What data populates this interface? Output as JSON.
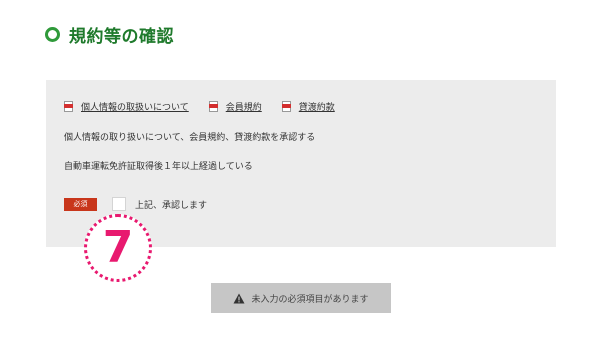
{
  "section": {
    "title": "規約等の確認"
  },
  "terms": {
    "links": [
      {
        "label": "個人情報の取扱いについて",
        "icon": "pdf-icon"
      },
      {
        "label": "会員規約",
        "icon": "pdf-icon"
      },
      {
        "label": "貸渡約款",
        "icon": "pdf-icon"
      }
    ],
    "consent_text": "個人情報の取り扱いについて、会員規約、貸渡約款を承認する",
    "license_text": "自動車運転免許証取得後１年以上経過している",
    "required_badge": "必須",
    "agree_label": "上記、承認します"
  },
  "annotation": {
    "step_number": "7"
  },
  "submit": {
    "label": "未入力の必須項目があります",
    "icon": "warning-icon"
  },
  "colors": {
    "heading": "#1f7a2c",
    "heading_icon": "#2f9a3a",
    "panel": "#ececec",
    "required_badge": "#c8361b",
    "annotation": "#e8196f",
    "button_disabled": "#c6c6c6"
  }
}
